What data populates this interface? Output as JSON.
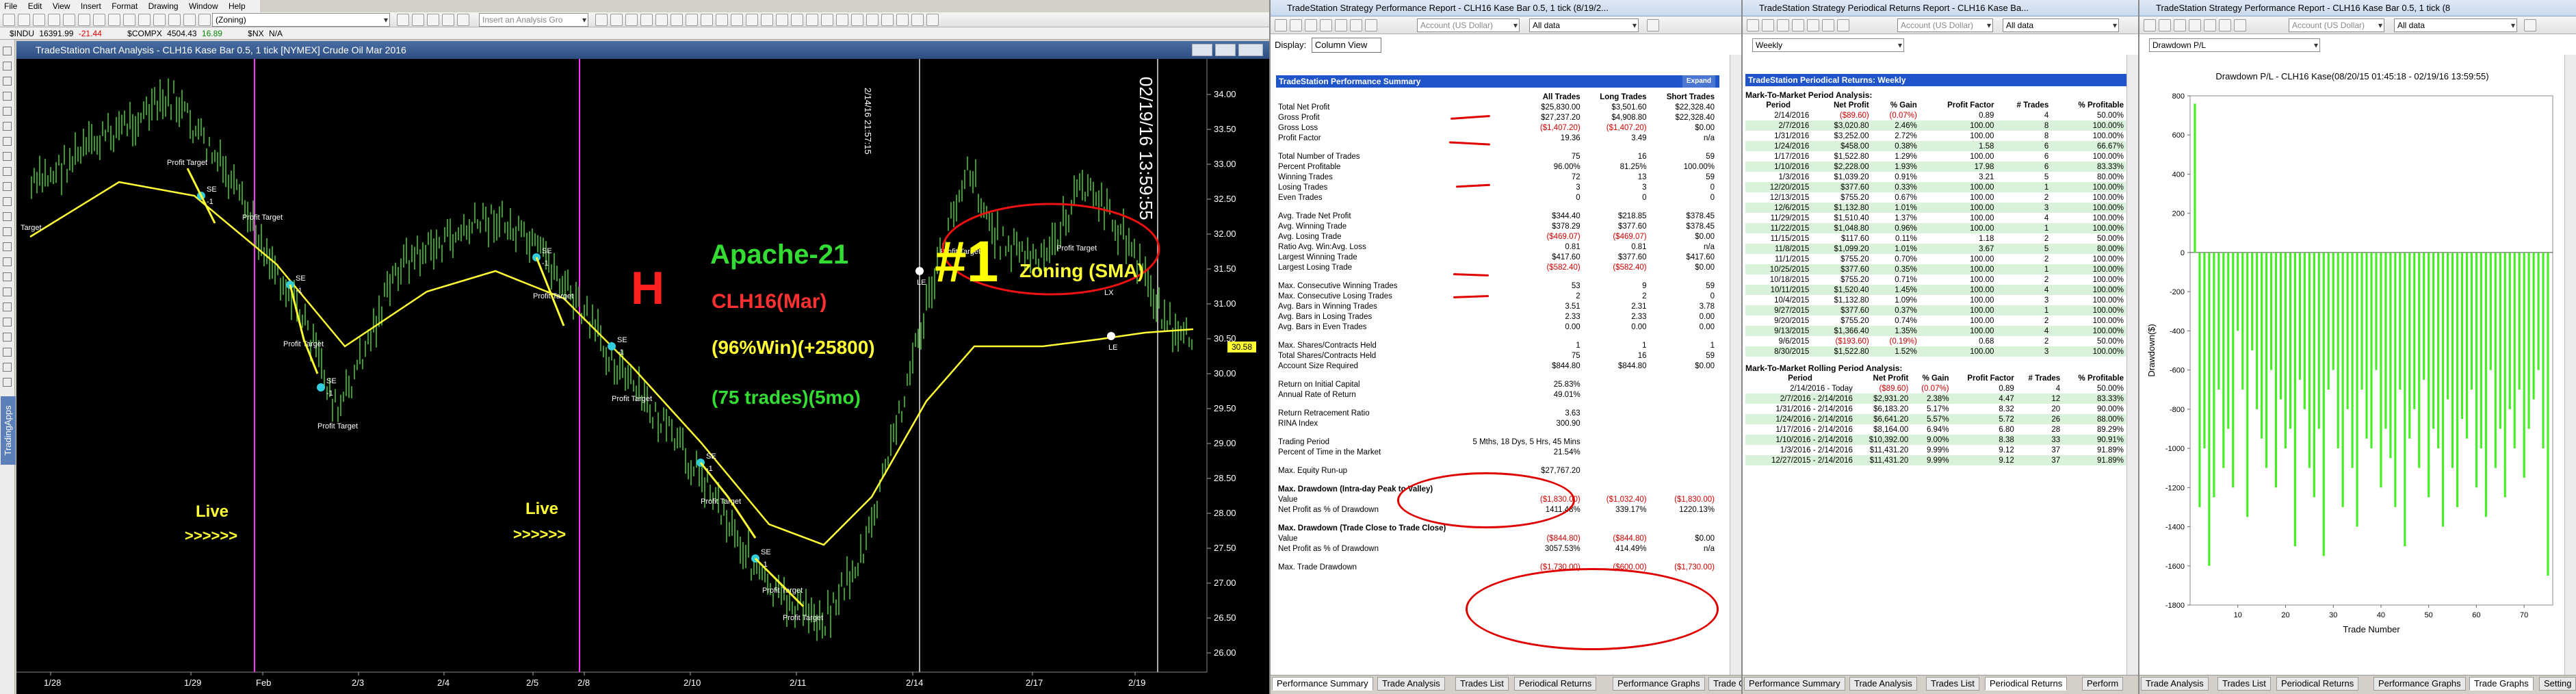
{
  "main_menu": [
    "File",
    "Edit",
    "View",
    "Insert",
    "Format",
    "Drawing",
    "Window",
    "Help"
  ],
  "main_toolbar": {
    "workspace_combo": "(Zoning)",
    "insert_combo": "Insert an Analysis Gro"
  },
  "quotes": [
    {
      "symbol": "$INDU",
      "last": "16391.99",
      "chg": "-21.44"
    },
    {
      "symbol": "$COMPX",
      "last": "4504.43",
      "chg": "16.89"
    },
    {
      "symbol": "$NX",
      "last": "N/A",
      "chg": ""
    }
  ],
  "chart": {
    "window_title": "TradeStation Chart Analysis - CLH16 Kase Bar 0.5, 1 tick [NYMEX] Crude Oil Mar 2016",
    "side_tab": "TradingApps",
    "price_labels": [
      "34.00",
      "33.50",
      "33.00",
      "32.50",
      "32.00",
      "31.50",
      "31.00",
      "30.50",
      "30.00",
      "29.50",
      "29.00",
      "28.50",
      "28.00",
      "27.50",
      "27.00",
      "26.50",
      "26.00"
    ],
    "date_labels": [
      "1/28",
      "1/29",
      "Feb",
      "2/3",
      "2/4",
      "2/5",
      "2/8",
      "2/10",
      "2/11",
      "2/14",
      "2/17",
      "2/19"
    ],
    "last_price": "30.58",
    "rotated_ts1": "2/14/16 21:57:15",
    "rotated_ts2": "02/19/16 13:59:55",
    "overlay_h": "H",
    "overlay_name": "Apache-21",
    "overlay_symbol": "CLH16(Mar)",
    "overlay_stats": "(96%Win)(+25800)",
    "overlay_trades": "(75 trades)(5mo)",
    "overlay_rank": "#1",
    "overlay_zoning": "Zoning (SMA)",
    "live1": "Live",
    "arrows1": ">>>>>>",
    "live2": "Live",
    "arrows2": ">>>>>>",
    "pt_label": "Profit Target",
    "se_label": "SE",
    "le_label": "LE",
    "lx_label": "LX",
    "target_label": "Target",
    "minus_one": "-1"
  },
  "perf": {
    "window_title": "TradeStation Strategy Performance Report - CLH16 Kase Bar 0.5, 1 tick (8/19/2...",
    "account_combo": "Account (US Dollar)",
    "data_combo": "All data",
    "display_label": "Display:",
    "display_value": "Column View",
    "header": "TradeStation Performance Summary",
    "expand": "Expand",
    "columns": [
      "All Trades",
      "Long Trades",
      "Short Trades"
    ],
    "rows1": [
      [
        "Total Net Profit",
        "$25,830.00",
        "$3,501.60",
        "$22,328.40"
      ],
      [
        "Gross Profit",
        "$27,237.20",
        "$4,908.80",
        "$22,328.40"
      ],
      [
        "Gross Loss",
        "($1,407.20)",
        "($1,407.20)",
        "$0.00"
      ],
      [
        "Profit Factor",
        "19.36",
        "3.49",
        "n/a"
      ]
    ],
    "rows2": [
      [
        "Total Number of Trades",
        "75",
        "16",
        "59"
      ],
      [
        "Percent Profitable",
        "96.00%",
        "81.25%",
        "100.00%"
      ],
      [
        "Winning Trades",
        "72",
        "13",
        "59"
      ],
      [
        "Losing Trades",
        "3",
        "3",
        "0"
      ],
      [
        "Even Trades",
        "0",
        "0",
        "0"
      ]
    ],
    "rows3": [
      [
        "Avg. Trade Net Profit",
        "$344.40",
        "$218.85",
        "$378.45"
      ],
      [
        "Avg. Winning Trade",
        "$378.29",
        "$377.60",
        "$378.45"
      ],
      [
        "Avg. Losing Trade",
        "($469.07)",
        "($469.07)",
        "$0.00"
      ],
      [
        "Ratio Avg. Win:Avg. Loss",
        "0.81",
        "0.81",
        "n/a"
      ],
      [
        "Largest Winning Trade",
        "$417.60",
        "$377.60",
        "$417.60"
      ],
      [
        "Largest Losing Trade",
        "($582.40)",
        "($582.40)",
        "$0.00"
      ]
    ],
    "rows4": [
      [
        "Max. Consecutive Winning Trades",
        "53",
        "9",
        "59"
      ],
      [
        "Max. Consecutive Losing Trades",
        "2",
        "2",
        "0"
      ],
      [
        "Avg. Bars in Winning Trades",
        "3.51",
        "2.31",
        "3.78"
      ],
      [
        "Avg. Bars in Losing Trades",
        "2.33",
        "2.33",
        "0.00"
      ],
      [
        "Avg. Bars in Even Trades",
        "0.00",
        "0.00",
        "0.00"
      ]
    ],
    "rows5": [
      [
        "Max. Shares/Contracts Held",
        "1",
        "1",
        "1"
      ],
      [
        "Total Shares/Contracts Held",
        "75",
        "16",
        "59"
      ],
      [
        "Account Size Required",
        "$844.80",
        "$844.80",
        "$0.00"
      ]
    ],
    "rows6": [
      [
        "Return on Initial Capital",
        "25.83%",
        "",
        ""
      ],
      [
        "Annual Rate of Return",
        "49.01%",
        "",
        ""
      ]
    ],
    "rows7": [
      [
        "Return Retracement Ratio",
        "3.63",
        "",
        ""
      ],
      [
        "RINA Index",
        "300.90",
        "",
        ""
      ]
    ],
    "rows8": [
      [
        "Trading Period",
        "5 Mths, 18 Dys, 5 Hrs, 45 Mins",
        "",
        ""
      ],
      [
        "Percent of Time in the Market",
        "21.54%",
        "",
        ""
      ]
    ],
    "rows9": [
      [
        "Max. Equity Run-up",
        "$27,767.20",
        "",
        ""
      ]
    ],
    "dd1_title": "Max. Drawdown (Intra-day Peak to Valley)",
    "dd1": [
      [
        "Value",
        "($1,830.00)",
        "($1,032.40)",
        "($1,830.00)"
      ],
      [
        "Net Profit as % of Drawdown",
        "1411.48%",
        "339.17%",
        "1220.13%"
      ]
    ],
    "dd2_title": "Max. Drawdown (Trade Close to Trade Close)",
    "dd2": [
      [
        "Value",
        "($844.80)",
        "($844.80)",
        "$0.00"
      ],
      [
        "Net Profit as % of Drawdown",
        "3057.53%",
        "414.49%",
        "n/a"
      ]
    ],
    "dd3": [
      [
        "Max. Trade Drawdown",
        "($1,730.00)",
        "($600.00)",
        "($1,730.00)"
      ]
    ],
    "tabs": [
      "Performance Summary",
      "Trade Analysis",
      "Trades List",
      "Periodical Returns",
      "Performance Graphs",
      "Trade Graphs"
    ]
  },
  "periodical": {
    "window_title": "TradeStation Strategy Periodical Returns Report - CLH16 Kase Ba...",
    "account_combo": "Account (US Dollar)",
    "data_combo": "All data",
    "period_combo": "Weekly",
    "header": "TradeStation Periodical Returns: Weekly",
    "m2m_title": "Mark-To-Market Period Analysis:",
    "columns": [
      "Period",
      "Net Profit",
      "% Gain",
      "Profit Factor",
      "# Trades",
      "% Profitable"
    ],
    "rows": [
      [
        "2/14/2016",
        "($89.60)",
        "(0.07%)",
        "0.89",
        "4",
        "50.00%"
      ],
      [
        "2/7/2016",
        "$3,020.80",
        "2.46%",
        "100.00",
        "8",
        "100.00%"
      ],
      [
        "1/31/2016",
        "$3,252.00",
        "2.72%",
        "100.00",
        "8",
        "100.00%"
      ],
      [
        "1/24/2016",
        "$458.00",
        "0.38%",
        "1.58",
        "6",
        "66.67%"
      ],
      [
        "1/17/2016",
        "$1,522.80",
        "1.29%",
        "100.00",
        "6",
        "100.00%"
      ],
      [
        "1/10/2016",
        "$2,228.00",
        "1.93%",
        "17.98",
        "6",
        "83.33%"
      ],
      [
        "1/3/2016",
        "$1,039.20",
        "0.91%",
        "3.21",
        "5",
        "80.00%"
      ],
      [
        "12/20/2015",
        "$377.60",
        "0.33%",
        "100.00",
        "1",
        "100.00%"
      ],
      [
        "12/13/2015",
        "$755.20",
        "0.67%",
        "100.00",
        "2",
        "100.00%"
      ],
      [
        "12/6/2015",
        "$1,132.80",
        "1.01%",
        "100.00",
        "3",
        "100.00%"
      ],
      [
        "11/29/2015",
        "$1,510.40",
        "1.37%",
        "100.00",
        "4",
        "100.00%"
      ],
      [
        "11/22/2015",
        "$1,048.80",
        "0.96%",
        "100.00",
        "1",
        "100.00%"
      ],
      [
        "11/15/2015",
        "$117.60",
        "0.11%",
        "1.18",
        "2",
        "50.00%"
      ],
      [
        "11/8/2015",
        "$1,099.20",
        "1.01%",
        "3.67",
        "5",
        "80.00%"
      ],
      [
        "11/1/2015",
        "$755.20",
        "0.70%",
        "100.00",
        "2",
        "100.00%"
      ],
      [
        "10/25/2015",
        "$377.60",
        "0.35%",
        "100.00",
        "1",
        "100.00%"
      ],
      [
        "10/18/2015",
        "$755.20",
        "0.71%",
        "100.00",
        "2",
        "100.00%"
      ],
      [
        "10/11/2015",
        "$1,520.40",
        "1.45%",
        "100.00",
        "4",
        "100.00%"
      ],
      [
        "10/4/2015",
        "$1,132.80",
        "1.09%",
        "100.00",
        "3",
        "100.00%"
      ],
      [
        "9/27/2015",
        "$377.60",
        "0.37%",
        "100.00",
        "1",
        "100.00%"
      ],
      [
        "9/20/2015",
        "$755.20",
        "0.74%",
        "100.00",
        "2",
        "100.00%"
      ],
      [
        "9/13/2015",
        "$1,366.40",
        "1.35%",
        "100.00",
        "4",
        "100.00%"
      ],
      [
        "9/6/2015",
        "($193.60)",
        "(0.19%)",
        "0.68",
        "2",
        "50.00%"
      ],
      [
        "8/30/2015",
        "$1,522.80",
        "1.52%",
        "100.00",
        "3",
        "100.00%"
      ]
    ],
    "rolling_title": "Mark-To-Market Rolling Period Analysis:",
    "rolling": [
      [
        "2/14/2016 - Today",
        "($89.60)",
        "(0.07%)",
        "0.89",
        "4",
        "50.00%"
      ],
      [
        "2/7/2016 - 2/14/2016",
        "$2,931.20",
        "2.38%",
        "4.47",
        "12",
        "83.33%"
      ],
      [
        "1/31/2016 - 2/14/2016",
        "$6,183.20",
        "5.17%",
        "8.32",
        "20",
        "90.00%"
      ],
      [
        "1/24/2016 - 2/14/2016",
        "$6,641.20",
        "5.57%",
        "5.72",
        "26",
        "88.00%"
      ],
      [
        "1/17/2016 - 2/14/2016",
        "$8,164.00",
        "6.94%",
        "6.80",
        "28",
        "89.29%"
      ],
      [
        "1/10/2016 - 2/14/2016",
        "$10,392.00",
        "9.00%",
        "8.38",
        "33",
        "90.91%"
      ],
      [
        "1/3/2016 - 2/14/2016",
        "$11,431.20",
        "9.99%",
        "9.12",
        "37",
        "91.89%"
      ],
      [
        "12/27/2015 - 2/14/2016",
        "$11,431.20",
        "9.99%",
        "9.12",
        "37",
        "91.89%"
      ]
    ],
    "tabs": [
      "Performance Summary",
      "Trade Analysis",
      "Trades List",
      "Periodical Returns",
      "Perform"
    ]
  },
  "graphs": {
    "window_title": "TradeStation Strategy Performance Report - CLH16 Kase Bar 0.5, 1 tick (8",
    "account_combo": "Account (US Dollar)",
    "data_combo": "All data",
    "graph_combo": "Drawdown P/L",
    "tabs": [
      "Trade Analysis",
      "Trades List",
      "Periodical Returns",
      "Performance Graphs",
      "Trade Graphs",
      "Setting"
    ]
  },
  "chart_data": {
    "type": "bar",
    "title": "Drawdown P/L - CLH16 Kase(08/20/15 01:45:18 - 02/19/16 13:59:55)",
    "xlabel": "Trade Number",
    "ylabel": "Drawdown($)",
    "ylim": [
      -1800,
      800
    ],
    "yticks": [
      800,
      600,
      400,
      200,
      0,
      -200,
      -400,
      -600,
      -800,
      -1000,
      -1200,
      -1400,
      -1600,
      -1800
    ],
    "xticks": [
      10,
      20,
      30,
      40,
      50,
      60,
      70
    ],
    "x": [
      1,
      2,
      3,
      4,
      5,
      6,
      7,
      8,
      9,
      10,
      11,
      12,
      13,
      14,
      15,
      16,
      17,
      18,
      19,
      20,
      21,
      22,
      23,
      24,
      25,
      26,
      27,
      28,
      29,
      30,
      31,
      32,
      33,
      34,
      35,
      36,
      37,
      38,
      39,
      40,
      41,
      42,
      43,
      44,
      45,
      46,
      47,
      48,
      49,
      50,
      51,
      52,
      53,
      54,
      55,
      56,
      57,
      58,
      59,
      60,
      61,
      62,
      63,
      64,
      65,
      66,
      67,
      68,
      69,
      70,
      71,
      72,
      73,
      74,
      75
    ],
    "values": [
      760,
      -1300,
      -1000,
      -1600,
      -1250,
      -700,
      -1100,
      -900,
      -1200,
      -400,
      -700,
      -1350,
      -500,
      -800,
      -950,
      -1100,
      -600,
      -1200,
      -750,
      -1000,
      -900,
      -1500,
      -650,
      -800,
      -1100,
      -1250,
      -900,
      -1550,
      -700,
      -600,
      -1000,
      -1300,
      -800,
      -1100,
      -1400,
      -700,
      -950,
      -1000,
      -600,
      -1200,
      -900,
      -1050,
      -1300,
      -700,
      -1500,
      -950,
      -800,
      -1100,
      -650,
      -1250,
      -900,
      -1000,
      -1400,
      -750,
      -1100,
      -1300,
      -850,
      -950,
      -700,
      -1200,
      -1000,
      -1350,
      -600,
      -1100,
      -900,
      -1250,
      -800,
      -1000,
      -700,
      -1150,
      -900,
      -750,
      -600,
      -1000,
      -1650
    ]
  },
  "colors": {
    "chart_bg": "#000000",
    "sma": "#ffff33",
    "bars": "#3c9a2c",
    "live_line": "#ff33ff",
    "header_blue": "#1f55c8",
    "drawdown_bar": "#44ee22",
    "annotation_red": "#e00000"
  }
}
